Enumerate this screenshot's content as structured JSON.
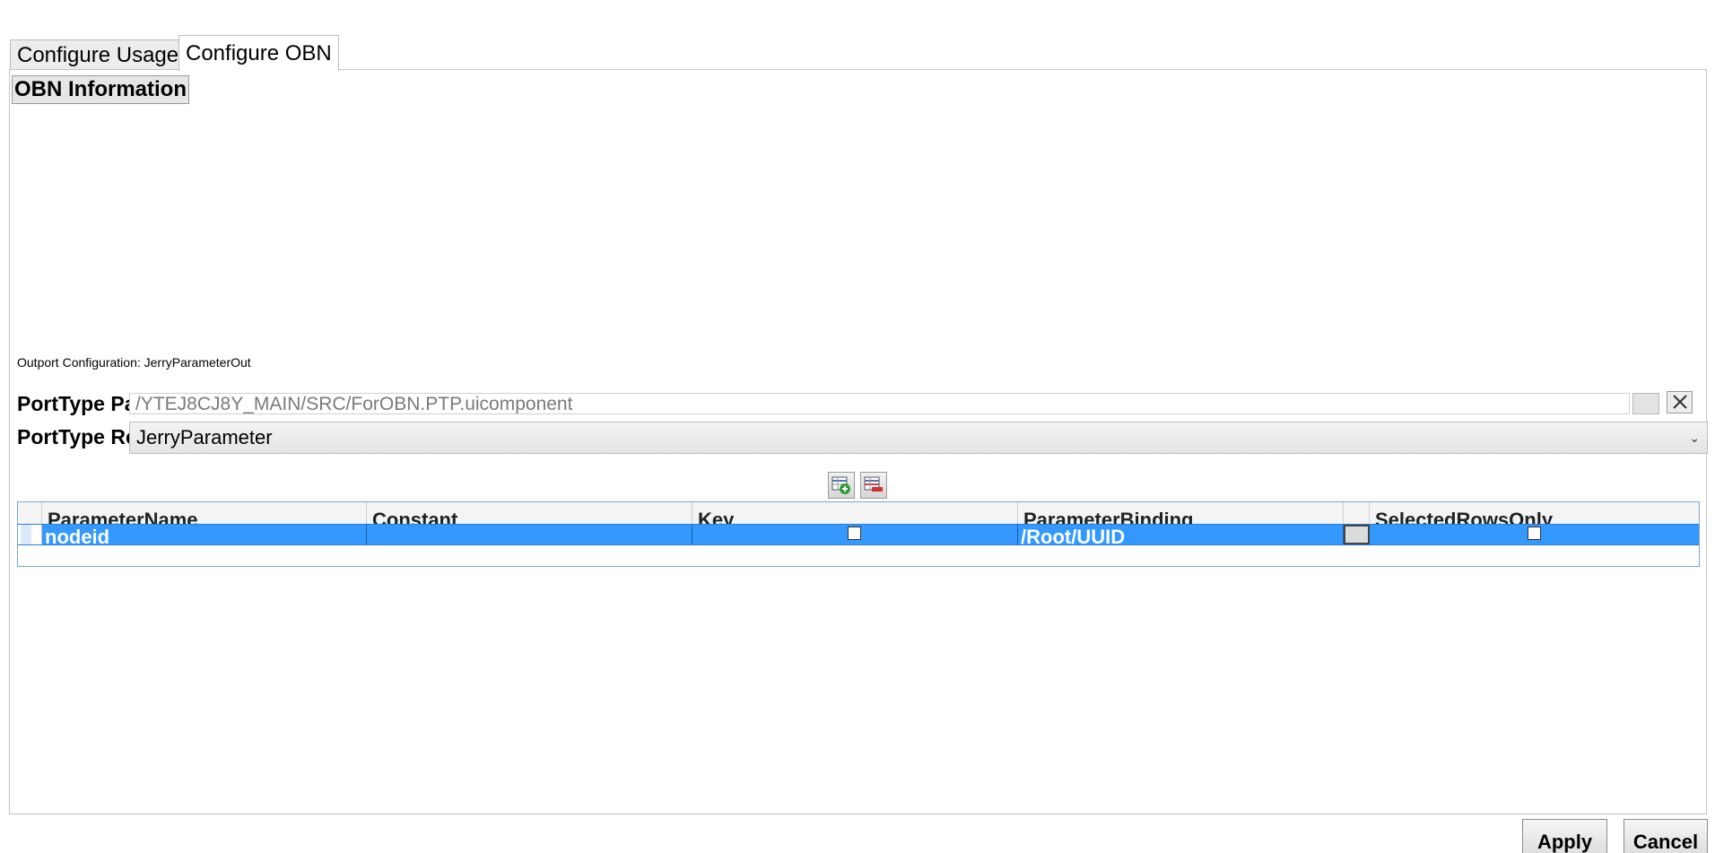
{
  "tabs": [
    {
      "label": "Configure Usage",
      "active": false
    },
    {
      "label": "Configure OBN",
      "active": true
    }
  ],
  "section": {
    "title": "OBN Information"
  },
  "outport": {
    "label": "Outport Configuration: JerryParameterOut"
  },
  "form": {
    "path_label": "PortType Pa",
    "path_value": "/YTEJ8CJ8Y_MAIN/SRC/ForOBN.PTP.uicomponent",
    "ref_label": "PortType Re",
    "ref_value": "JerryParameter"
  },
  "icons": {
    "clear": "close-icon",
    "chevron": "chevron-down-icon",
    "add_row": "add-row-icon",
    "remove_row": "remove-row-icon"
  },
  "grid": {
    "columns": [
      "ParameterName",
      "Constant",
      "Key",
      "ParameterBinding",
      "",
      "SelectedRowsOnly"
    ],
    "rows": [
      {
        "parameter_name": "nodeid",
        "constant": "",
        "key_checked": false,
        "parameter_binding": "/Root/UUID",
        "selected_rows_only_checked": false,
        "selected": true
      }
    ]
  },
  "buttons": {
    "apply": "Apply",
    "cancel": "Cancel"
  },
  "colors": {
    "selection": "#3399ff",
    "grid_border": "#7aa7d6"
  }
}
